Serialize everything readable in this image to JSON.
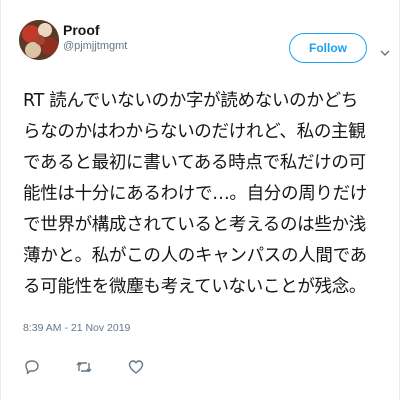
{
  "author": {
    "display_name": "Proof",
    "handle": "@pjmjjtmgmt"
  },
  "follow_label": "Follow",
  "tweet": {
    "lines": [
      "RT 読んでいないのか字が読めないのかどち",
      "らなのかはわからないのだけれど、私の主観",
      "であると最初に書いてある時点で私だけの可",
      "能性は十分にあるわけで…。自分の周りだけ",
      "で世界が構成されていると考えるのは些か浅",
      "薄かと。私がこの人のキャンパスの人間であ",
      "る可能性を微塵も考えていないことが残念。"
    ],
    "timestamp": "8:39 AM - 21 Nov 2019"
  },
  "icons": {
    "menu": "chevron-down-icon",
    "reply": "reply-icon",
    "retweet": "retweet-icon",
    "like": "heart-icon"
  },
  "colors": {
    "accent": "#1da1f2",
    "text": "#14171a",
    "muted": "#657786"
  }
}
